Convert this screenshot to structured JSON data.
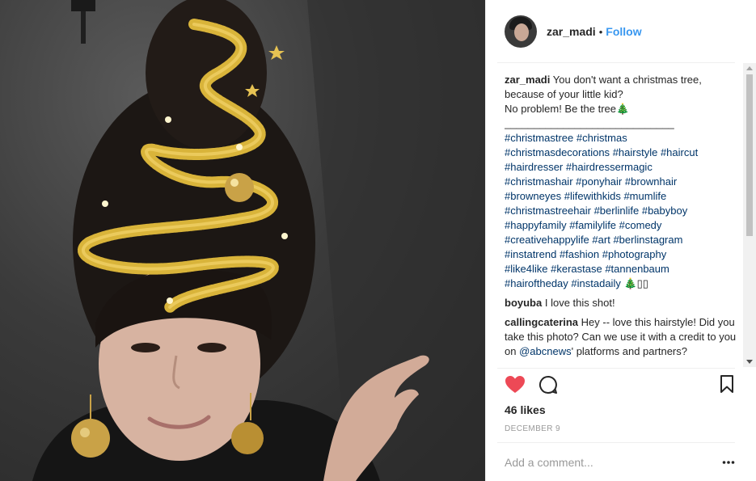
{
  "post": {
    "author": {
      "username": "zar_madi",
      "separator": "•",
      "follow_label": "Follow"
    },
    "caption": {
      "username": "zar_madi",
      "text": "You don't want a christmas tree,\nbecause of your little kid?\nNo problem! Be the tree🎄\n_____________________________",
      "hashtags": [
        [
          "#christmastree",
          "#christmas"
        ],
        [
          "#christmasdecorations",
          "#hairstyle",
          "#haircut"
        ],
        [
          "#hairdresser",
          "#hairdressermagic"
        ],
        [
          "#christmashair",
          "#ponyhair",
          "#brownhair"
        ],
        [
          "#browneyes",
          "#lifewithkids",
          "#mumlife"
        ],
        [
          "#christmastreehair",
          "#berlinlife",
          "#babyboy"
        ],
        [
          "#happyfamily",
          "#familylife",
          "#comedy"
        ],
        [
          "#creativehappylife",
          "#art",
          "#berlinstagram"
        ],
        [
          "#instatrend",
          "#fashion",
          "#photography"
        ],
        [
          "#like4like",
          "#kerastase",
          "#tannenbaum"
        ],
        [
          "#hairoftheday",
          "#instadaily",
          "🎄▯▯"
        ]
      ]
    },
    "comments": [
      {
        "username": "boyuba",
        "text": "I love this shot!"
      },
      {
        "username": "callingcaterina",
        "text_before": "Hey -- love this hairstyle! Did you take this photo? Can we use it with a credit to you on ",
        "mention": "@abcnews",
        "text_after": "' platforms and partners?"
      }
    ],
    "likes_label": "46 likes",
    "date": "DECEMBER 9",
    "add_comment_placeholder": "Add a comment...",
    "icons": {
      "like": "heart-icon",
      "comment": "comment-bubble-icon",
      "save": "bookmark-icon",
      "more": "more-options-icon"
    },
    "colors": {
      "like_red": "#ed4956",
      "link_blue": "#3897f0",
      "hashtag": "#003569",
      "muted": "#999999",
      "tinsel_gold": "#d9b43a"
    }
  }
}
